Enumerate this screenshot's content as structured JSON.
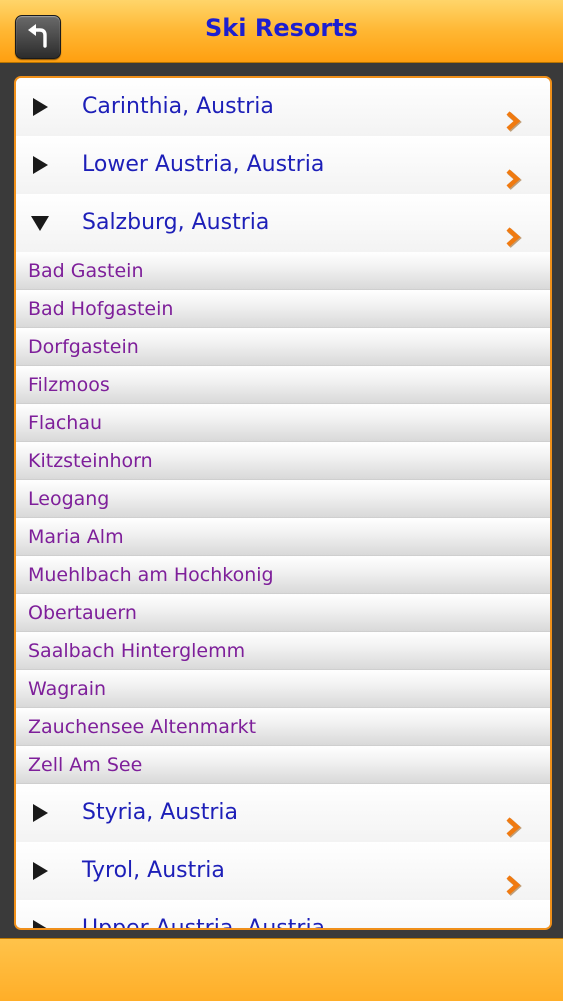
{
  "header": {
    "title": "Ski Resorts"
  },
  "regions_before": [
    {
      "label": "Carinthia, Austria",
      "expanded": false
    },
    {
      "label": "Lower Austria, Austria",
      "expanded": false
    },
    {
      "label": "Salzburg, Austria",
      "expanded": true
    }
  ],
  "resorts": [
    "Bad Gastein",
    "Bad Hofgastein",
    "Dorfgastein",
    "Filzmoos",
    "Flachau",
    "Kitzsteinhorn",
    "Leogang",
    "Maria Alm",
    "Muehlbach am Hochkonig",
    "Obertauern",
    "Saalbach Hinterglemm",
    "Wagrain",
    "Zauchensee Altenmarkt",
    "Zell Am See"
  ],
  "regions_after": [
    {
      "label": "Styria, Austria",
      "expanded": false
    },
    {
      "label": "Tyrol, Austria",
      "expanded": false
    },
    {
      "label": "Upper Austria, Austria",
      "expanded": false
    }
  ],
  "colors": {
    "header_orange": "#ffb733",
    "title_blue": "#1d1fd0",
    "region_text": "#1d1fb8",
    "resort_text": "#7e1f9a",
    "chevron_orange": "#f07a10"
  },
  "icons": {
    "back": "back-arrow-icon",
    "collapsed": "triangle-right-icon",
    "expanded": "triangle-down-icon",
    "chevron": "chevron-right-icon"
  }
}
